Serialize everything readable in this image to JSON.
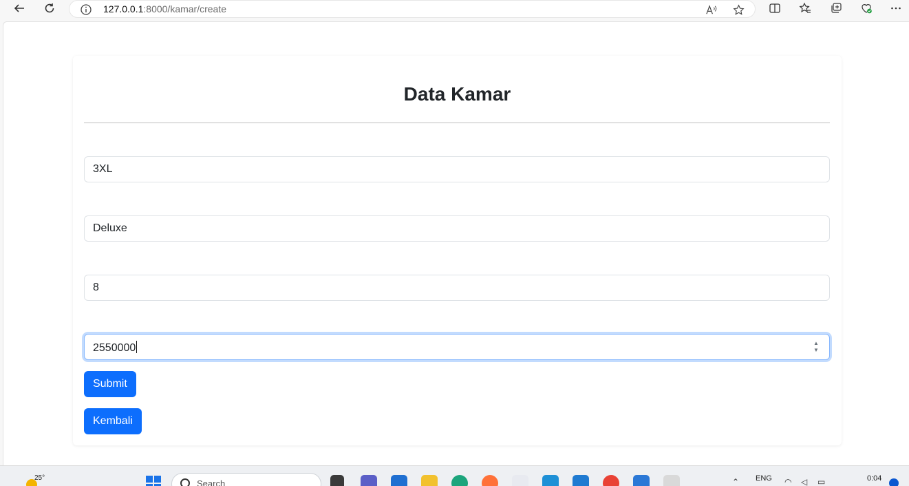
{
  "browser": {
    "url_host": "127.0.0.1",
    "url_path": ":8000/kamar/create"
  },
  "page": {
    "title": "Data Kamar",
    "fields": [
      {
        "value": "3XL"
      },
      {
        "value": "Deluxe"
      },
      {
        "value": "8"
      },
      {
        "value": "2550000"
      }
    ],
    "submit_label": "Submit",
    "back_label": "Kembali"
  },
  "taskbar": {
    "temperature": "25°",
    "search_placeholder": "Search",
    "language": "ENG",
    "time": "0:04"
  },
  "colors": {
    "primary": "#0d6efd",
    "focus_border": "#86b7fe"
  },
  "icons": [
    "back-icon",
    "reload-icon",
    "info-icon",
    "read-aloud-icon",
    "favorite-star-icon",
    "split-screen-icon",
    "favorites-icon",
    "collections-icon",
    "browser-essentials-icon",
    "more-icon",
    "start-icon",
    "search-icon"
  ]
}
